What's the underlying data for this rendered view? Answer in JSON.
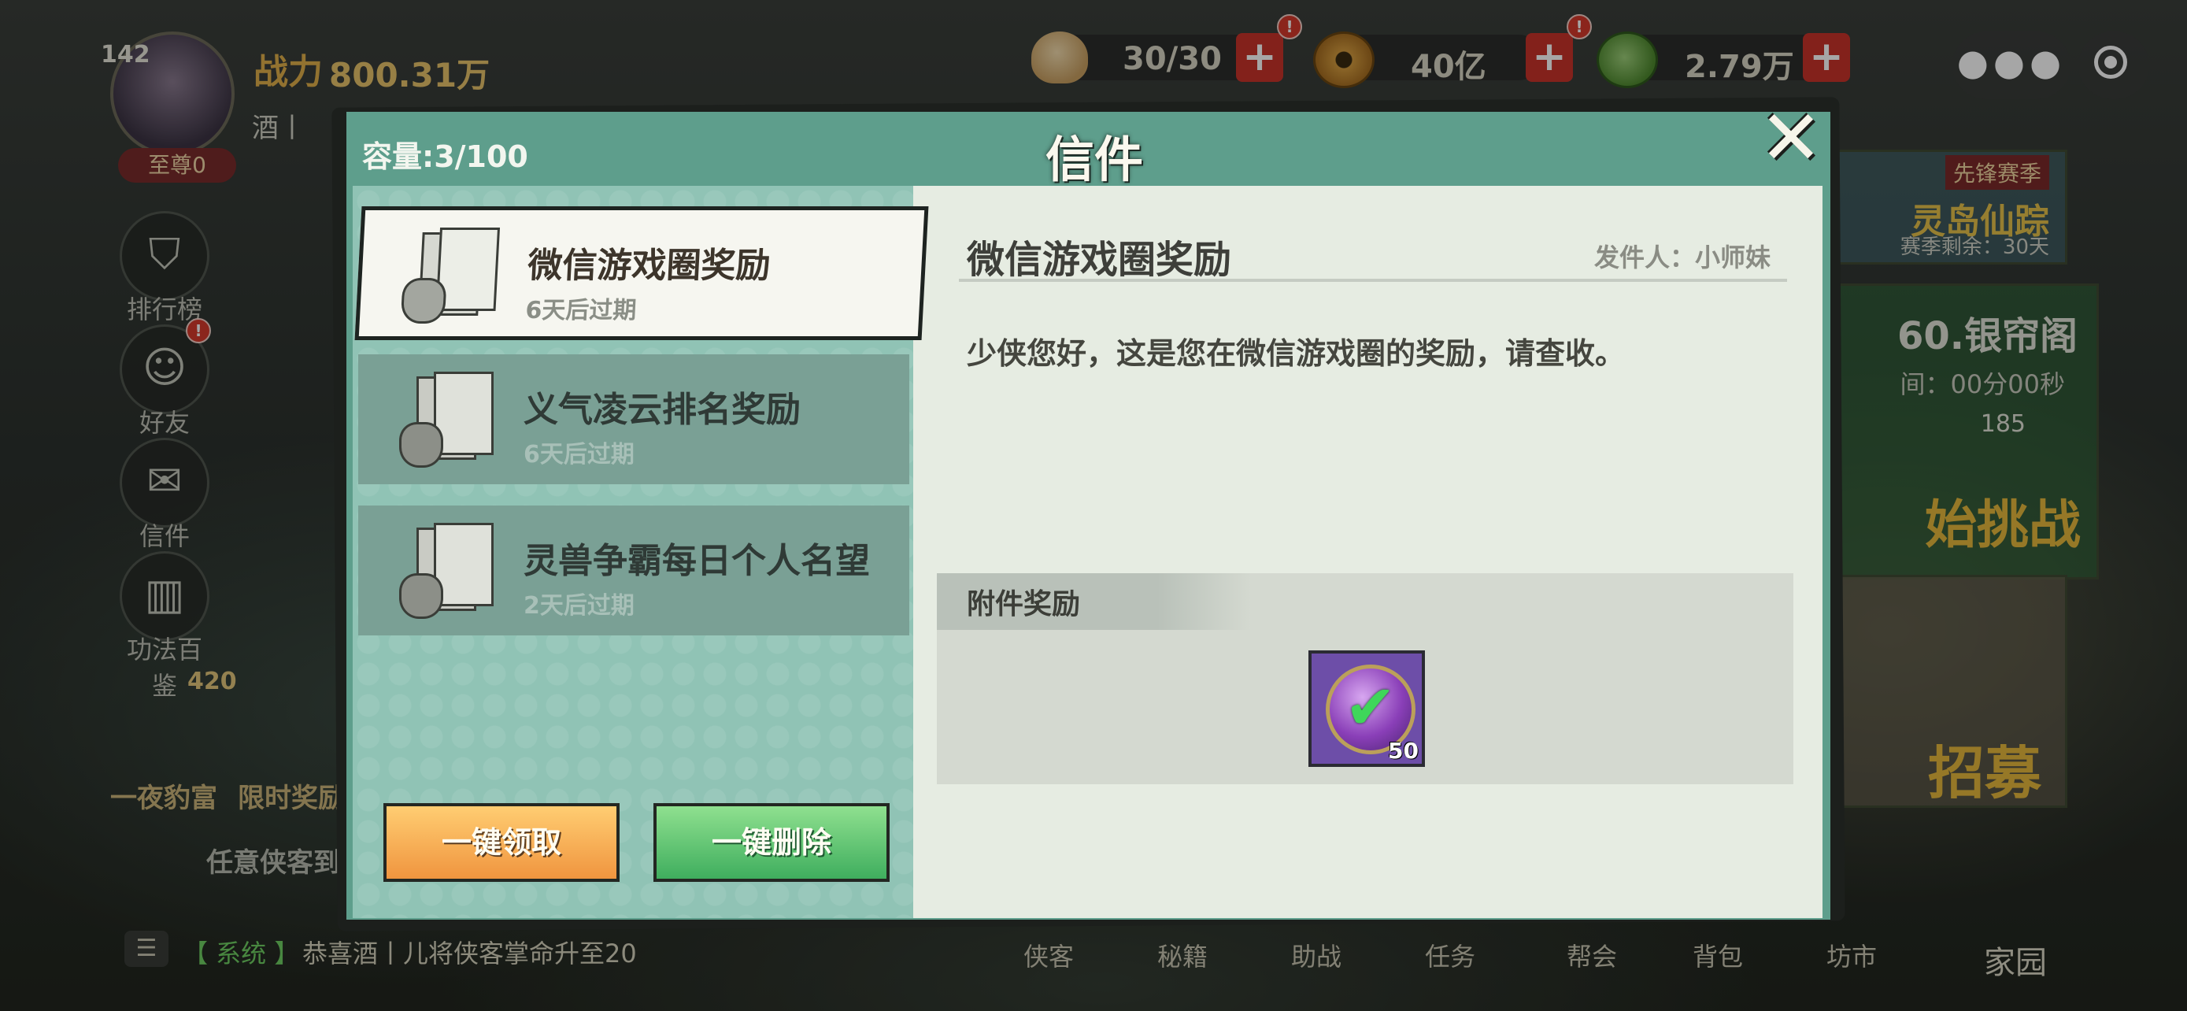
{
  "hud": {
    "level": "142",
    "power_label": "战力",
    "power_value": "800.31万",
    "guild": "酒丨",
    "rank": "至尊0",
    "resources": [
      {
        "name": "bun",
        "value": "30/30",
        "icon": "bun-icon"
      },
      {
        "name": "copper-coin",
        "value": "40亿",
        "icon": "copper-coin-icon"
      },
      {
        "name": "jade",
        "value": "2.79万",
        "icon": "jade-icon"
      }
    ],
    "plus": "+",
    "badge": "!"
  },
  "side_menu": [
    {
      "label": "排行榜",
      "icon": "leaderboard-icon",
      "glyph": "⛉"
    },
    {
      "label": "好友",
      "icon": "friends-icon",
      "glyph": "☺"
    },
    {
      "label": "信件",
      "icon": "mail-icon",
      "glyph": "✉"
    },
    {
      "label": "功法百鉴",
      "icon": "book-icon",
      "glyph": "▥"
    }
  ],
  "promos": {
    "count": "420",
    "item1": "一夜豹富",
    "item2": "限时奖励",
    "task": "任意侠客到",
    "season": "先锋赛季",
    "region": "灵岛仙踪",
    "season_remaining": "赛季剩余：30天",
    "tower": "60.银帘阁",
    "tower_time": "间：00分00秒",
    "tower_count": "185",
    "challenge": "始挑战",
    "recruit": "招募"
  },
  "chat": {
    "channel": "【 系统 】",
    "message": "恭喜酒丨儿将侠客掌命升至20"
  },
  "bottom_nav": [
    "侠客",
    "秘籍",
    "助战",
    "任务",
    "帮会",
    "背包",
    "坊市",
    "家园"
  ],
  "modal": {
    "title": "信件",
    "capacity": "容量:3/100",
    "close_glyph": "✕",
    "mails": [
      {
        "subject": "微信游戏圈奖励",
        "expiry": "6天后过期",
        "active": true
      },
      {
        "subject": "义气凌云排名奖励",
        "expiry": "6天后过期",
        "active": false
      },
      {
        "subject": "灵兽争霸每日个人名望",
        "expiry": "2天后过期",
        "active": false
      }
    ],
    "claim_all": "一键领取",
    "delete_all": "一键删除",
    "detail": {
      "subject": "微信游戏圈奖励",
      "sender": "发件人：小师妹",
      "body": "少侠您好，这是您在微信游戏圈的奖励，请查收。",
      "attachment_label": "附件奖励",
      "reward": {
        "icon": "purple-orb-icon",
        "quantity": "50",
        "claimed": true
      }
    }
  },
  "colors": {
    "modal_bg": "#5e9e8c",
    "list_bg": "#90c3b5",
    "detail_bg": "#e6ece2",
    "claim_orange": "#f0953f",
    "delete_green": "#3fae5e"
  }
}
